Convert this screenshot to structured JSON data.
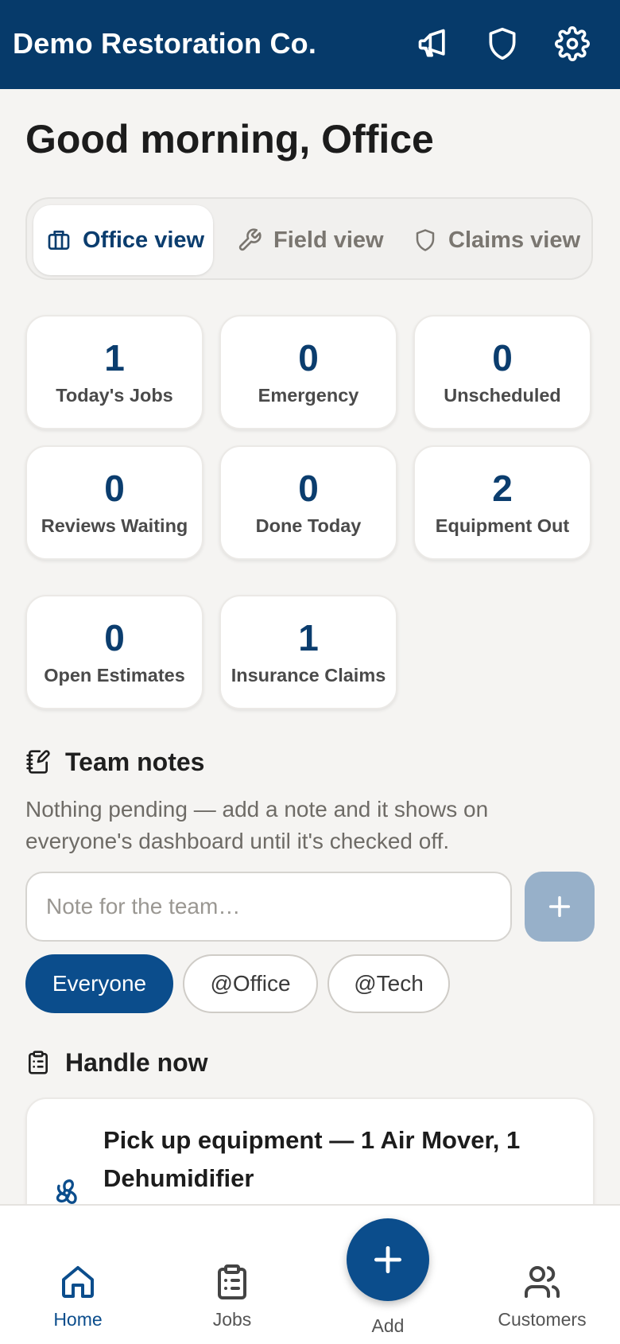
{
  "header": {
    "title": "Demo Restoration Co.",
    "icons": [
      "megaphone-icon",
      "shield-icon",
      "gear-icon"
    ]
  },
  "greeting": "Good morning, Office",
  "views": [
    {
      "label": "Office view",
      "icon": "briefcase-icon",
      "active": true
    },
    {
      "label": "Field view",
      "icon": "wrench-icon",
      "active": false
    },
    {
      "label": "Claims view",
      "icon": "shield-icon",
      "active": false
    }
  ],
  "stats": [
    {
      "value": "1",
      "label": "Today's Jobs"
    },
    {
      "value": "0",
      "label": "Emergency"
    },
    {
      "value": "0",
      "label": "Unscheduled"
    },
    {
      "value": "0",
      "label": "Reviews Waiting"
    },
    {
      "value": "0",
      "label": "Done Today"
    },
    {
      "value": "2",
      "label": "Equipment Out"
    },
    {
      "value": "0",
      "label": "Open Estimates"
    },
    {
      "value": "1",
      "label": "Insurance Claims"
    }
  ],
  "team_notes": {
    "heading": "Team notes",
    "description": "Nothing pending — add a note and it shows on everyone's dashboard until it's checked off.",
    "input_placeholder": "Note for the team…",
    "input_value": "",
    "audiences": [
      {
        "label": "Everyone",
        "active": true
      },
      {
        "label": "@Office",
        "active": false
      },
      {
        "label": "@Tech",
        "active": false
      }
    ]
  },
  "handle_now": {
    "heading": "Handle now",
    "tasks": [
      {
        "title": "Pick up equipment — 1 Air Mover, 1 Dehumidifier",
        "icon": "fan-icon"
      }
    ]
  },
  "bottom_nav": {
    "items": [
      {
        "label": "Home",
        "icon": "home-icon",
        "active": true
      },
      {
        "label": "Jobs",
        "icon": "clipboard-icon",
        "active": false
      },
      {
        "label": "Add",
        "icon": "plus-icon",
        "active": false
      },
      {
        "label": "Customers",
        "icon": "users-icon",
        "active": false
      }
    ]
  },
  "colors": {
    "header_bg": "#063a6a",
    "accent": "#0b4d8c",
    "stat_value": "#0b3d6e",
    "page_bg": "#f5f4f2"
  }
}
